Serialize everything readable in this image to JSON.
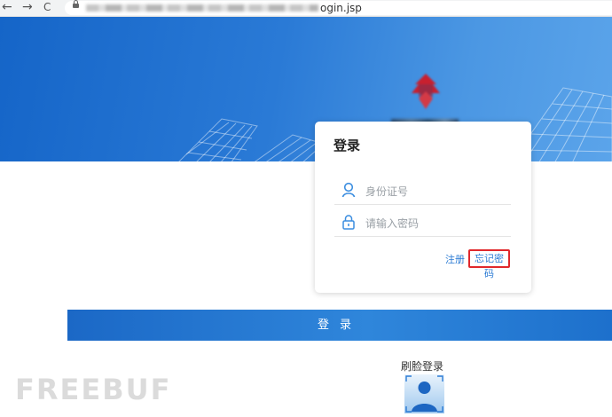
{
  "browser": {
    "back_icon": "←",
    "forward_icon": "→",
    "reload_icon": "C",
    "url_visible": "ogin.jsp"
  },
  "banner": {
    "primary_color": "#1565c8",
    "accent_color": "#5ba4ea"
  },
  "login": {
    "title": "登录",
    "id_placeholder": "身份证号",
    "password_placeholder": "请输入密码",
    "register_label": "注册",
    "forgot_label": "忘记密码",
    "highlight_color": "#e0282c"
  },
  "main": {
    "login_button_label": "登录",
    "face_login_label": "刷脸登录"
  },
  "watermark": "FREEBUF"
}
